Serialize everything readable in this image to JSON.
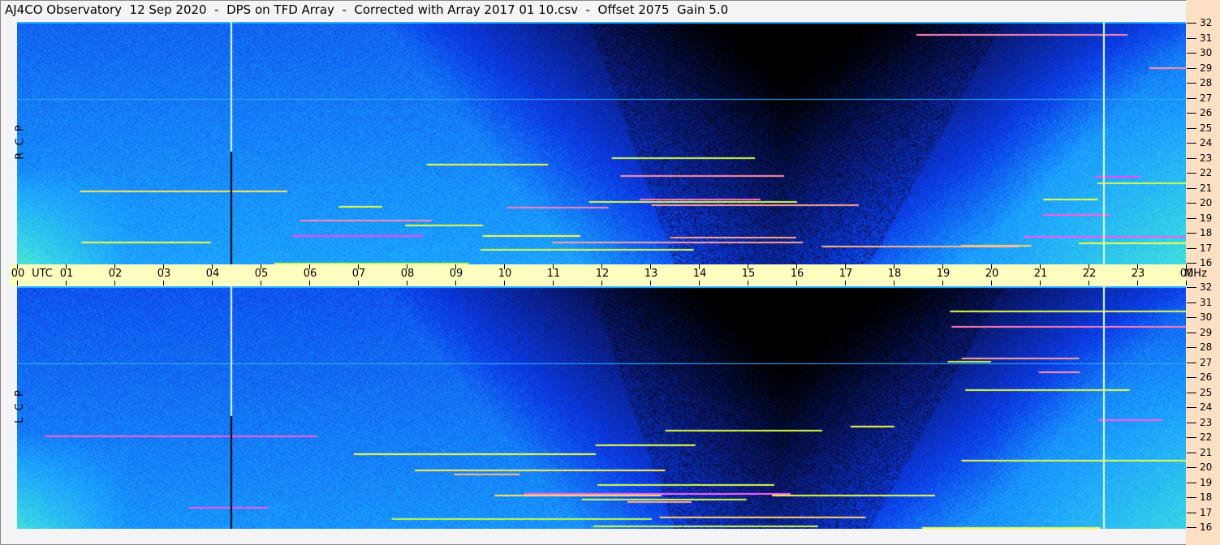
{
  "title": "AJ4CO Observatory  12 Sep 2020  -  DPS on TFD Array  -  Corrected with Array 2017 01 10.csv  -  Offset 2075  Gain 5.0",
  "chart_data": {
    "type": "heatmap",
    "title": "AJ4CO Observatory  12 Sep 2020  -  DPS on TFD Array  -  Corrected with Array 2017 01 10.csv  -  Offset 2075  Gain 5.0",
    "xlabel": "UTC",
    "ylabel": "MHz",
    "x_range_hours": [
      0,
      24
    ],
    "y_range_mhz": [
      16,
      32
    ],
    "x_ticks": [
      "00",
      "01",
      "02",
      "03",
      "04",
      "05",
      "06",
      "07",
      "08",
      "09",
      "10",
      "11",
      "12",
      "13",
      "14",
      "15",
      "16",
      "17",
      "18",
      "19",
      "20",
      "21",
      "22",
      "23",
      "00"
    ],
    "x_unit_label": "UTC",
    "y_unit_label": "MHz",
    "y_ticks": [
      "32",
      "31",
      "30",
      "29",
      "28",
      "27",
      "26",
      "25",
      "24",
      "23",
      "22",
      "21",
      "20",
      "19",
      "18",
      "17",
      "16"
    ],
    "panels": [
      {
        "name": "top",
        "label": "R  C  P"
      },
      {
        "name": "bottom",
        "label": "L  C  P"
      }
    ],
    "markers_utc_hours": [
      4.4,
      22.3
    ],
    "colormap": [
      "#000000",
      "#0a1a7a",
      "#0b3ce8",
      "#1aa0ff",
      "#3fe0e0",
      "#a0ff60",
      "#ffff40",
      "#ff40ff",
      "#ffffff"
    ]
  }
}
